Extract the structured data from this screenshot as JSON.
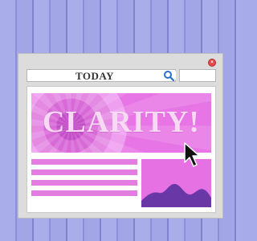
{
  "window": {
    "address_text": "TODAY",
    "hero_title": "CLARITY!"
  },
  "icons": {
    "close": "close-icon",
    "search": "search-icon",
    "cursor": "mouse-pointer-icon"
  },
  "colors": {
    "background": "#a7abea",
    "accent_pink": "#e571e2",
    "chart_fill": "#6a38a6",
    "close_button": "#e5484d",
    "search_icon": "#2a6fd1"
  }
}
